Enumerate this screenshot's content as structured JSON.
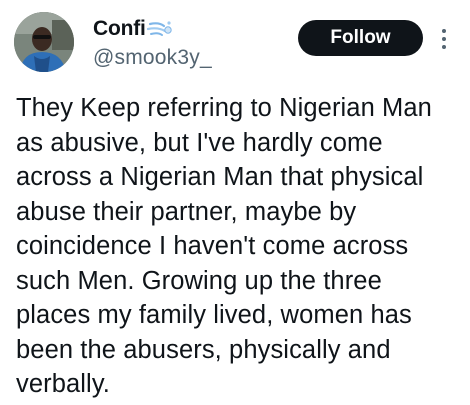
{
  "author": {
    "display_name": "Confi",
    "handle": "@smook3y_",
    "name_emoji_icon": "dashing-away-icon",
    "avatar_icon": "profile-photo"
  },
  "actions": {
    "follow_label": "Follow",
    "more_icon": "more-vertical-icon"
  },
  "tweet": {
    "text": "They Keep referring to Nigerian Man as abusive, but I've hardly come across a Nigerian Man that physical abuse their partner, maybe by coincidence I haven't come across such Men. Growing up the three places my family lived, women has been the abusers, physically and verbally."
  },
  "colors": {
    "text_primary": "#0f1419",
    "text_secondary": "#536471",
    "follow_bg": "#0f1419",
    "follow_text": "#ffffff"
  }
}
